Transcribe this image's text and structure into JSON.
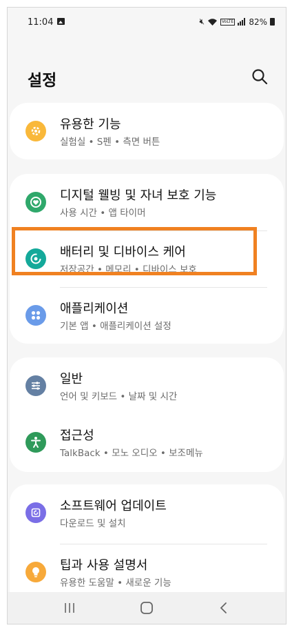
{
  "status_bar": {
    "time": "11:04",
    "battery": "82%",
    "net_label": "VoLTE"
  },
  "header": {
    "title": "설정"
  },
  "items": [
    {
      "label": "유용한 기능",
      "sub": "실험실 • S펜 • 측면 버튼",
      "color": "#f9b83a",
      "icon": "puzzle-gear-icon"
    },
    {
      "label": "디지털 웰빙 및 자녀 보호 기능",
      "sub": "사용 시간 • 앱 타이머",
      "color": "#2fa86b",
      "icon": "heart-ring-icon"
    },
    {
      "label": "배터리 및 디바이스 케어",
      "sub": "저장공간 • 메모리 • 디바이스 보호",
      "color": "#14a99a",
      "icon": "device-care-icon"
    },
    {
      "label": "애플리케이션",
      "sub": "기본 앱 • 애플리케이션 설정",
      "color": "#6a9be9",
      "icon": "apps-grid-icon"
    },
    {
      "label": "일반",
      "sub": "언어 및 키보드 • 날짜 및 시간",
      "color": "#6480a3",
      "icon": "sliders-icon"
    },
    {
      "label": "접근성",
      "sub": "TalkBack • 모노 오디오 • 보조메뉴",
      "color": "#2f9a5a",
      "icon": "accessibility-icon"
    },
    {
      "label": "소프트웨어 업데이트",
      "sub": "다운로드 및 설치",
      "color": "#7a6ee6",
      "icon": "update-icon"
    },
    {
      "label": "팁과 사용 설명서",
      "sub": "유용한 도움말 • 새로운 기능",
      "color": "#f7a93a",
      "icon": "lightbulb-icon"
    }
  ],
  "colors": {
    "highlight": "#f08121",
    "background": "#f6f6f6"
  }
}
